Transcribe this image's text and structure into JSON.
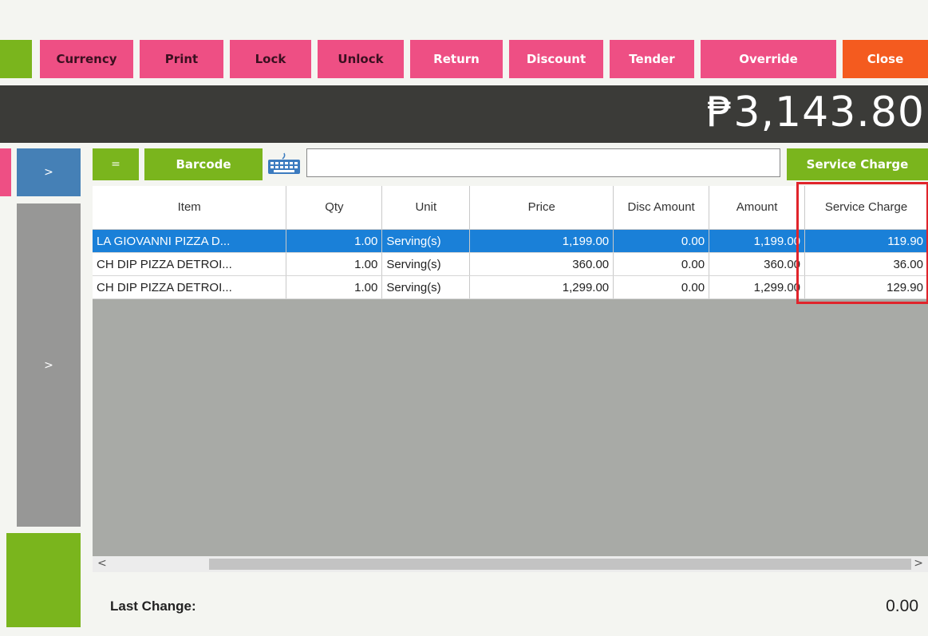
{
  "toolbar": {
    "buttons": [
      {
        "label": "Currency"
      },
      {
        "label": "Print"
      },
      {
        "label": "Lock"
      },
      {
        "label": "Unlock"
      },
      {
        "label": "Return"
      },
      {
        "label": "Discount"
      },
      {
        "label": "Tender"
      },
      {
        "label": "Override"
      },
      {
        "label": "Close"
      }
    ]
  },
  "total": "₱3,143.80",
  "left_panel": {
    "arrow_top": ">",
    "arrow_mid": ">"
  },
  "search": {
    "equals_label": "=",
    "barcode_label": "Barcode",
    "value": "",
    "service_charge_label": "Service Charge"
  },
  "grid": {
    "columns": [
      "Item",
      "Qty",
      "Unit",
      "Price",
      "Disc Amount",
      "Amount",
      "Service Charge"
    ],
    "rows": [
      {
        "item": "LA GIOVANNI PIZZA D...",
        "qty": "1.00",
        "unit": "Serving(s)",
        "price": "1,199.00",
        "disc": "0.00",
        "amount": "1,199.00",
        "service": "119.90",
        "selected": true
      },
      {
        "item": "CH DIP PIZZA DETROI...",
        "qty": "1.00",
        "unit": "Serving(s)",
        "price": "360.00",
        "disc": "0.00",
        "amount": "360.00",
        "service": "36.00",
        "selected": false
      },
      {
        "item": "CH DIP PIZZA DETROI...",
        "qty": "1.00",
        "unit": "Serving(s)",
        "price": "1,299.00",
        "disc": "0.00",
        "amount": "1,299.00",
        "service": "129.90",
        "selected": false
      }
    ]
  },
  "scroll": {
    "left": "<",
    "right": ">"
  },
  "last_change": {
    "label": "Last Change:",
    "value": "0.00"
  },
  "colors": {
    "pink": "#ee4f84",
    "orange": "#f45b1f",
    "green": "#7ab51d",
    "blue": "#4580b6",
    "selected_row": "#1a80d8",
    "highlight": "#e0242b"
  }
}
